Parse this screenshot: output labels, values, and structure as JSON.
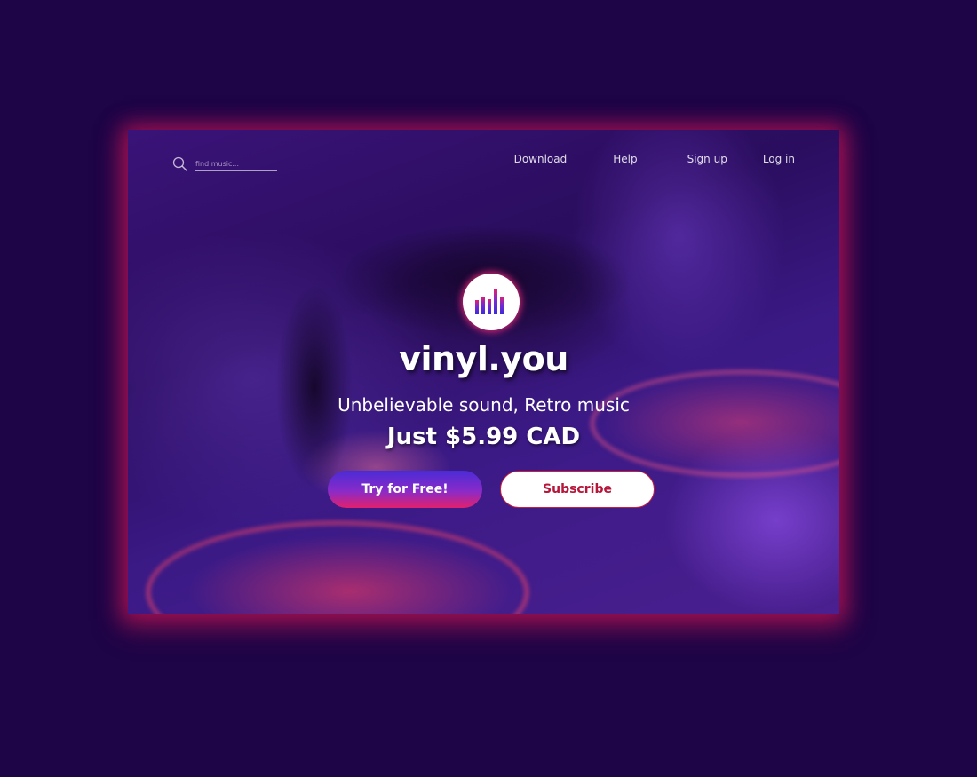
{
  "search": {
    "placeholder": "find music..."
  },
  "nav": {
    "items": [
      {
        "label": "Download"
      },
      {
        "label": "Help"
      },
      {
        "label": "Sign up"
      },
      {
        "label": "Log in"
      }
    ]
  },
  "hero": {
    "logo_icon": "equalizer-bars-icon",
    "brand": "vinyl.you",
    "tagline": "Unbelievable sound, Retro music",
    "price": "Just $5.99 CAD",
    "primary_button": "Try for Free!",
    "secondary_button": "Subscribe"
  },
  "colors": {
    "page_background": "#1d0547",
    "glow": "#e0206e",
    "subscribe_text": "#b5163a",
    "button_gradient_top": "#4a2bd6",
    "button_gradient_bottom": "#e0206e"
  }
}
